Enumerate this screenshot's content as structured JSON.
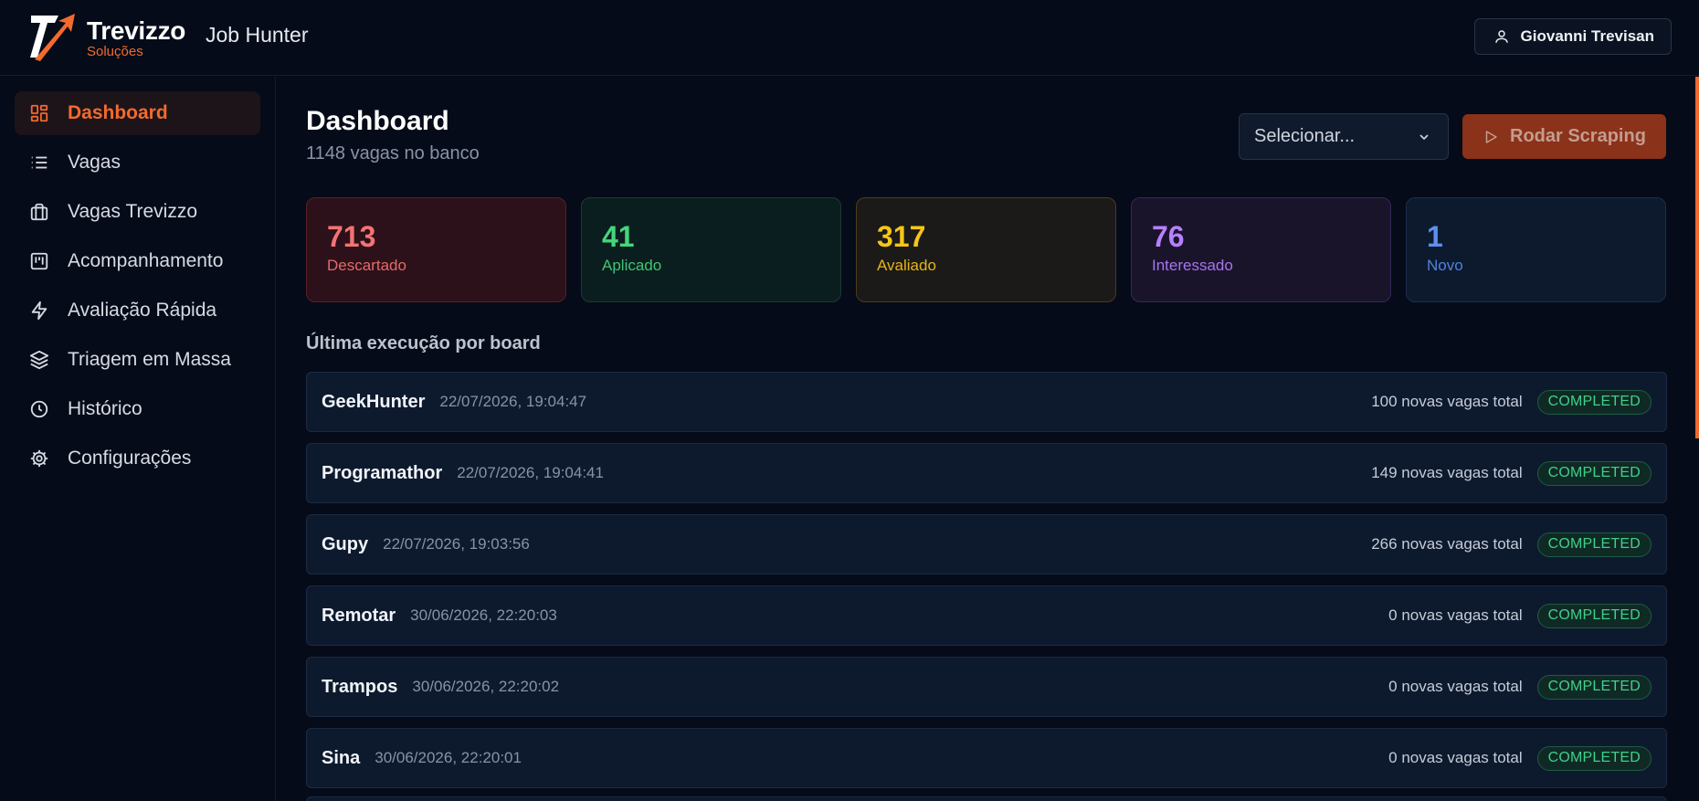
{
  "header": {
    "brand_name": "Trevizzo",
    "brand_sub": "Soluções",
    "app_name": "Job Hunter",
    "user_name": "Giovanni Trevisan"
  },
  "sidebar": {
    "items": [
      {
        "label": "Dashboard",
        "icon": "dashboard-icon",
        "active": true
      },
      {
        "label": "Vagas",
        "icon": "list-icon"
      },
      {
        "label": "Vagas Trevizzo",
        "icon": "briefcase-icon"
      },
      {
        "label": "Acompanhamento",
        "icon": "kanban-icon"
      },
      {
        "label": "Avaliação Rápida",
        "icon": "lightning-icon"
      },
      {
        "label": "Triagem em Massa",
        "icon": "layers-icon"
      },
      {
        "label": "Histórico",
        "icon": "clock-icon"
      },
      {
        "label": "Configurações",
        "icon": "gear-icon"
      }
    ]
  },
  "main": {
    "title": "Dashboard",
    "subtitle": "1148 vagas no banco",
    "select_value": "Selecionar...",
    "run_label": "Rodar Scraping",
    "section_title": "Última execução por board"
  },
  "stats": [
    {
      "value": "713",
      "label": "Descartado",
      "color": "#f47373"
    },
    {
      "value": "41",
      "label": "Aplicado",
      "color": "#43d67d"
    },
    {
      "value": "317",
      "label": "Avaliado",
      "color": "#f5c518"
    },
    {
      "value": "76",
      "label": "Interessado",
      "color": "#b780ff"
    },
    {
      "value": "1",
      "label": "Novo",
      "color": "#5d8ff0"
    }
  ],
  "runs": [
    {
      "board": "GeekHunter",
      "time": "22/07/2026, 19:04:47",
      "count": "100 novas vagas total",
      "status": "COMPLETED"
    },
    {
      "board": "Programathor",
      "time": "22/07/2026, 19:04:41",
      "count": "149 novas vagas total",
      "status": "COMPLETED"
    },
    {
      "board": "Gupy",
      "time": "22/07/2026, 19:03:56",
      "count": "266 novas vagas total",
      "status": "COMPLETED"
    },
    {
      "board": "Remotar",
      "time": "30/06/2026, 22:20:03",
      "count": "0 novas vagas total",
      "status": "COMPLETED"
    },
    {
      "board": "Trampos",
      "time": "30/06/2026, 22:20:02",
      "count": "0 novas vagas total",
      "status": "COMPLETED"
    },
    {
      "board": "Sina",
      "time": "30/06/2026, 22:20:01",
      "count": "0 novas vagas total",
      "status": "COMPLETED"
    }
  ],
  "colors": {
    "accent": "#f26a2e",
    "background": "#050b18",
    "status_completed": "#3fd08a"
  }
}
